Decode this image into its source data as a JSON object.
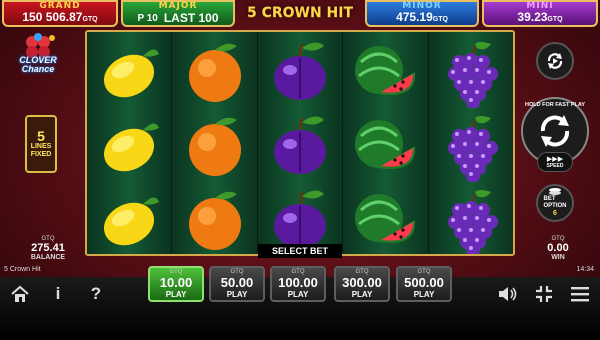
{
  "jackpots": {
    "grand": {
      "title": "GRAND",
      "value": "150 506.87",
      "currency": "GTQ"
    },
    "major": {
      "title": "MAJOR",
      "prefix": "P 10",
      "value": "LAST 100"
    },
    "minor": {
      "title": "MINOR",
      "value": "475.19",
      "currency": "GTQ"
    },
    "mini": {
      "title": "MINI",
      "value": "39.23",
      "currency": "GTQ"
    }
  },
  "game_title": "5 CROWN HIT",
  "logo": {
    "line1": "CLOVER",
    "line2": "Chance"
  },
  "reels": [
    [
      "lemon",
      "lemon",
      "lemon"
    ],
    [
      "orange",
      "orange",
      "orange"
    ],
    [
      "plum",
      "plum",
      "plum"
    ],
    [
      "watermelon",
      "watermelon",
      "watermelon"
    ],
    [
      "grapes",
      "grapes",
      "grapes"
    ]
  ],
  "lines": {
    "count": "5",
    "label1": "LINES",
    "label2": "FIXED"
  },
  "balance": {
    "currency": "GTQ",
    "value": "275.41",
    "label": "BALANCE"
  },
  "win": {
    "currency": "GTQ",
    "value": "0.00",
    "label": "WIN"
  },
  "select_bet_label": "SELECT BET",
  "controls": {
    "hold_text": "HOLD FOR FAST PLAY",
    "speed_label": "SPEED",
    "speed_icon": "fast-forward-icon",
    "bet_option_label1": "BET",
    "bet_option_label2": "OPTION",
    "bet_option_value": "6"
  },
  "game_name": "5 Crown Hit",
  "clock": "14:34",
  "bets": [
    {
      "currency": "GTQ",
      "value": "10.00",
      "label": "PLAY",
      "active": true
    },
    {
      "currency": "GTQ",
      "value": "50.00",
      "label": "PLAY",
      "active": false
    },
    {
      "currency": "GTQ",
      "value": "100.00",
      "label": "PLAY",
      "active": false
    },
    {
      "currency": "GTQ",
      "value": "300.00",
      "label": "PLAY",
      "active": false
    },
    {
      "currency": "GTQ",
      "value": "500.00",
      "label": "PLAY",
      "active": false
    }
  ],
  "bottom_icons": [
    "home-icon",
    "info-icon",
    "help-icon",
    "sound-icon",
    "fullscreen-icon",
    "menu-icon"
  ],
  "colors": {
    "reel_bg": "#145b34",
    "frame": "#d4a94a",
    "active_bet": "#4ec03a",
    "title": "#ffd34a"
  }
}
